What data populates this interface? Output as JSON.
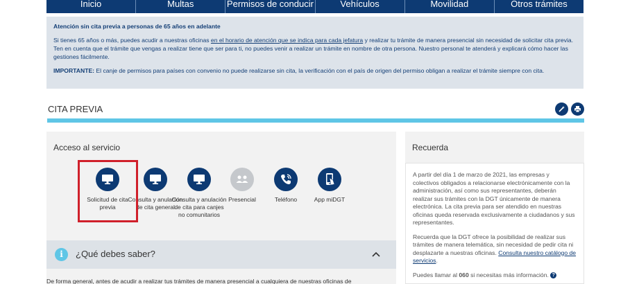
{
  "nav": {
    "items": [
      {
        "label": "Inicio"
      },
      {
        "label": "Multas"
      },
      {
        "label": "Permisos de conducir"
      },
      {
        "label": "Vehículos"
      },
      {
        "label": "Movilidad"
      },
      {
        "label": "Otros trámites"
      }
    ]
  },
  "notice": {
    "title": "Atención sin cita previa a personas de 65 años en adelante",
    "p1_pre": "Si tienes 65 años o más, puedes acudir a nuestras oficinas ",
    "p1_link": "en el horario de atención que se indica para cada jefatura",
    "p1_post": " y realizar tu trámite de manera presencial sin necesidad de solicitar cita previa. Ten en cuenta que el trámite que vengas a realizar tiene que ser para ti, no puedes venir a realizar un trámite en nombre de otra persona. Nuestro personal te atenderá y explicará cómo hacer las gestiones fácilmente.",
    "important_label": "IMPORTANTE:",
    "important_text": " El canje de permisos para países con convenio no puede realizarse sin cita, la verificación con el país de origen del permiso obligan a realizar el trámite siempre con cita."
  },
  "section": {
    "title": "CITA PREVIA"
  },
  "acceso": {
    "title": "Acceso al servicio",
    "services": [
      {
        "label": "Solicitud de cita previa",
        "icon": "monitor-icon",
        "enabled": true,
        "selected": true
      },
      {
        "label": "Consulta y anulación de cita general",
        "icon": "monitor-icon",
        "enabled": true
      },
      {
        "label": "Consulta y anulación de cita para canjes no comunitarios",
        "icon": "monitor-icon",
        "enabled": true
      },
      {
        "label": "Presencial",
        "icon": "people-icon",
        "enabled": false
      },
      {
        "label": "Teléfono",
        "icon": "phone-icon",
        "enabled": true
      },
      {
        "label": "App miDGT",
        "icon": "mobile-app-icon",
        "enabled": true
      }
    ]
  },
  "saber": {
    "label": "¿Qué debes saber?",
    "bottom_pre": "De forma general, antes de acudir a realizar tus trámites de manera presencial a ",
    "bottom_link": "cualquiera de nuestras oficinas de"
  },
  "recuerda": {
    "title": "Recuerda",
    "p1": "A partir del día 1 de marzo de 2021, las empresas y colectivos obligados a relacionarse electrónicamente con la administración, así como sus representantes, deberán realizar sus trámites con la DGT únicamente de manera electrónica. La cita previa para ser atendido en nuestras oficinas queda reservada exclusivamente a ciudadanos y sus representantes.",
    "p2_pre": "Recuerda que la DGT ofrece la posibilidad de realizar sus trámites de manera telemática, sin necesidad de pedir cita ni desplazarte a nuestras oficinas. ",
    "p2_link": "Consulta nuestro catálogo de servicios",
    "p2_post": ".",
    "p3_pre": "Puedes llamar al ",
    "p3_number": "060",
    "p3_post": " si necesitas más información.",
    "help_glyph": "?"
  },
  "colors": {
    "navy": "#0d3a73",
    "cyan": "#5fc6e6",
    "selected_border": "#d0202b",
    "disabled": "#c5c8cc"
  }
}
